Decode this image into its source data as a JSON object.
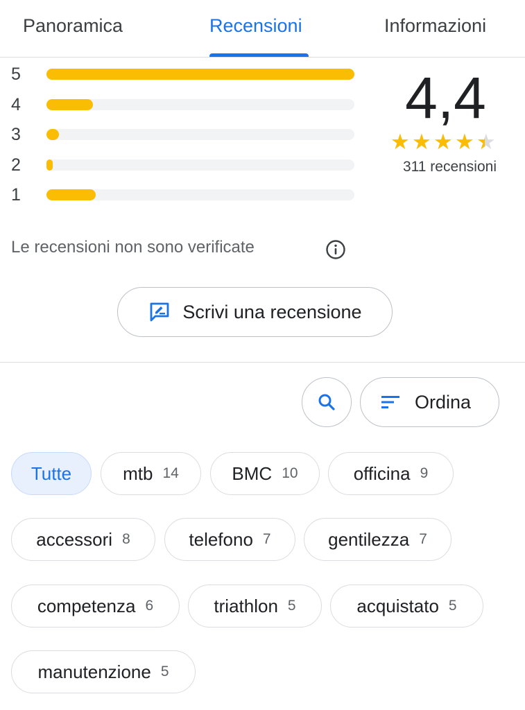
{
  "tabs": [
    {
      "label": "Panoramica",
      "active": false
    },
    {
      "label": "Recensioni",
      "active": true
    },
    {
      "label": "Informazioni",
      "active": false
    }
  ],
  "histogram": [
    {
      "stars": "5",
      "fraction": 1.0
    },
    {
      "stars": "4",
      "fraction": 0.15
    },
    {
      "stars": "3",
      "fraction": 0.04
    },
    {
      "stars": "2",
      "fraction": 0.02
    },
    {
      "stars": "1",
      "fraction": 0.16
    }
  ],
  "summary": {
    "rating": "4,4",
    "rating_value": 4.4,
    "review_count": "311 recensioni"
  },
  "notice": {
    "text": "Le recensioni non sono verificate",
    "icon": "info-icon"
  },
  "write_review": {
    "label": "Scrivi una recensione",
    "icon": "write-review-icon"
  },
  "controls": {
    "search_icon": "search-icon",
    "sort_label": "Ordina",
    "sort_icon": "sort-icon"
  },
  "chips": [
    {
      "label": "Tutte",
      "count": "",
      "selected": true
    },
    {
      "label": "mtb",
      "count": "14",
      "selected": false
    },
    {
      "label": "BMC",
      "count": "10",
      "selected": false
    },
    {
      "label": "officina",
      "count": "9",
      "selected": false
    },
    {
      "label": "accessori",
      "count": "8",
      "selected": false
    },
    {
      "label": "telefono",
      "count": "7",
      "selected": false
    },
    {
      "label": "gentilezza",
      "count": "7",
      "selected": false
    },
    {
      "label": "competenza",
      "count": "6",
      "selected": false
    },
    {
      "label": "triathlon",
      "count": "5",
      "selected": false
    },
    {
      "label": "acquistato",
      "count": "5",
      "selected": false
    },
    {
      "label": "manutenzione",
      "count": "5",
      "selected": false
    }
  ],
  "colors": {
    "accent": "#1a73e8",
    "star": "#fbbc04",
    "track": "#f1f3f4",
    "chip_selected_bg": "#e8f0fe"
  }
}
